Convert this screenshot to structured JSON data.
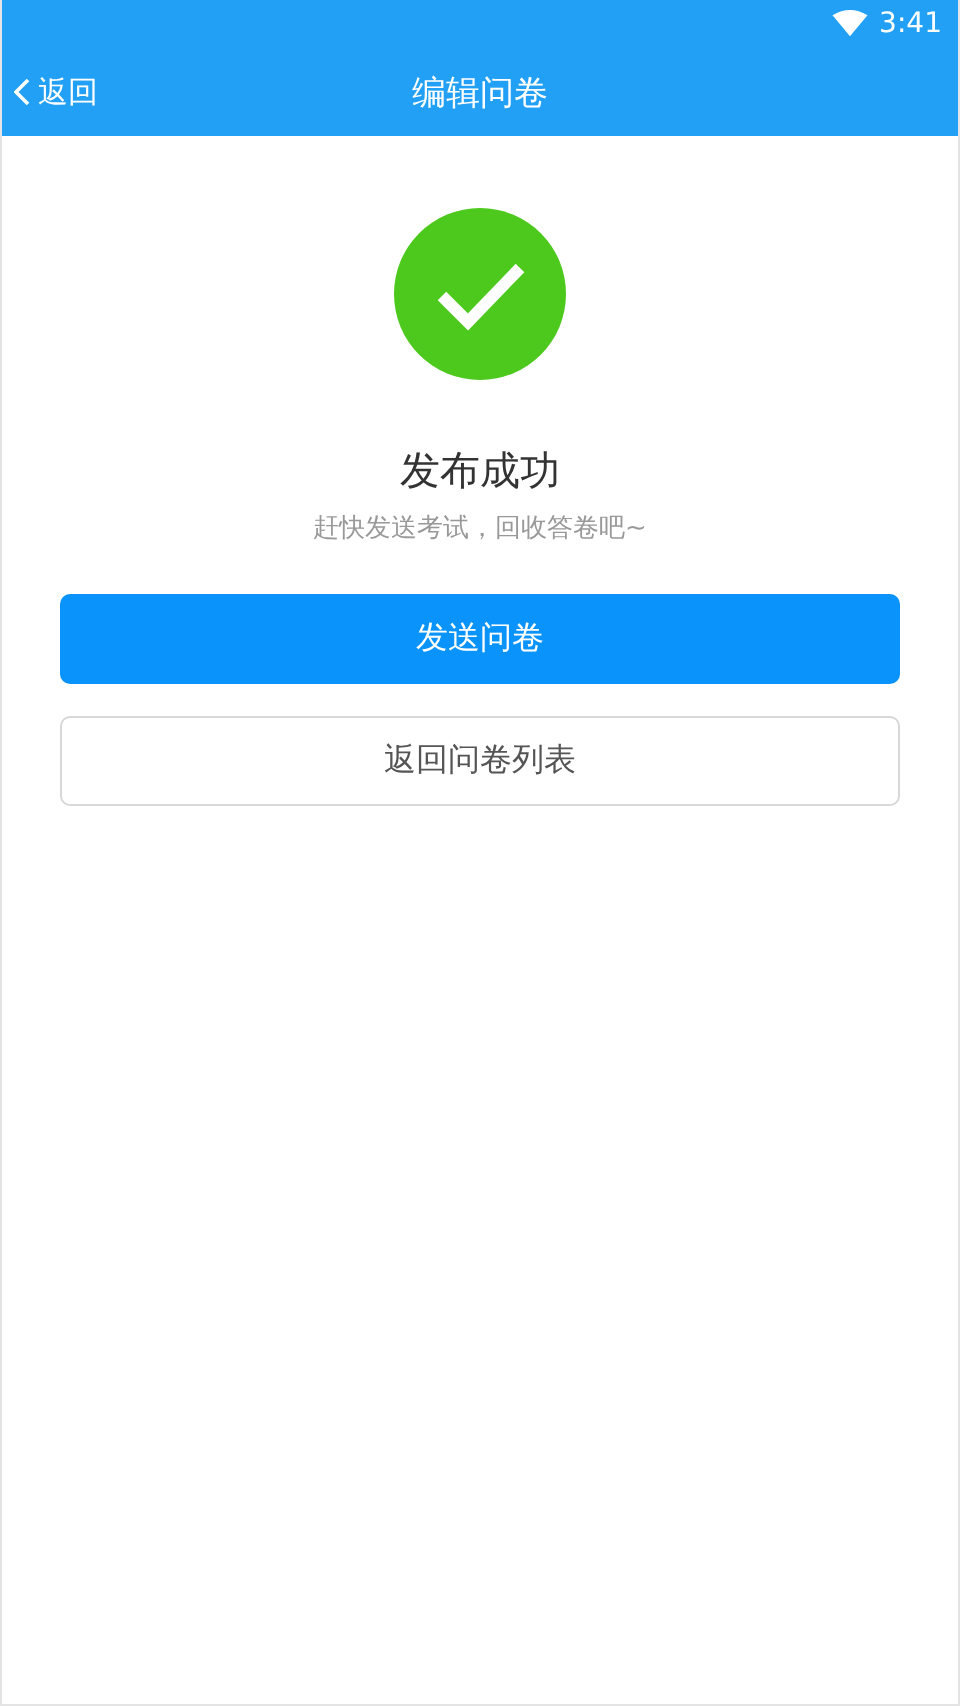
{
  "status_bar": {
    "time": "3:41"
  },
  "nav": {
    "back_label": "返回",
    "title": "编辑问卷"
  },
  "result": {
    "title": "发布成功",
    "subtitle": "赶快发送考试，回收答卷吧~"
  },
  "buttons": [
    {
      "label": "发送问卷",
      "kind": "primary"
    },
    {
      "label": "返回问卷列表",
      "kind": "secondary"
    }
  ]
}
